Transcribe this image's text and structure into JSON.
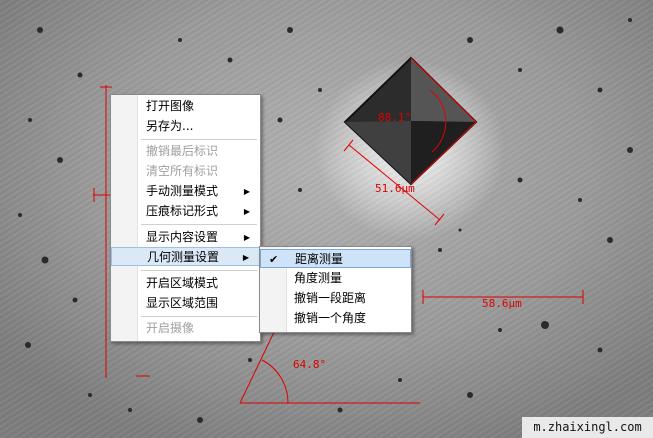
{
  "image": {
    "measurements": {
      "indent_angle": "88.1°",
      "indent_edge": "51.6μm",
      "distance": "58.6μm",
      "angle": "64.8°"
    },
    "watermark": "m.zhaixingl.com",
    "annotation_color": "#e00000"
  },
  "context_menu": {
    "items": [
      {
        "label": "打开图像",
        "enabled": true
      },
      {
        "label": "另存为...",
        "enabled": true
      },
      {
        "label": "撤销最后标识",
        "enabled": false
      },
      {
        "label": "清空所有标识",
        "enabled": false
      },
      {
        "label": "手动测量模式",
        "enabled": true,
        "submenu": true
      },
      {
        "label": "压痕标记形式",
        "enabled": true,
        "submenu": true
      },
      {
        "label": "显示内容设置",
        "enabled": true,
        "submenu": true
      },
      {
        "label": "几何测量设置",
        "enabled": true,
        "submenu": true,
        "selected": true
      },
      {
        "label": "开启区域模式",
        "enabled": true
      },
      {
        "label": "显示区域范围",
        "enabled": true
      },
      {
        "label": "开启摄像",
        "enabled": false
      }
    ]
  },
  "submenu": {
    "items": [
      {
        "label": "距离测量",
        "checked": true,
        "highlighted": true
      },
      {
        "label": "角度测量",
        "checked": false
      },
      {
        "label": "撤销一段距离",
        "checked": false
      },
      {
        "label": "撤销一个角度",
        "checked": false
      }
    ]
  }
}
